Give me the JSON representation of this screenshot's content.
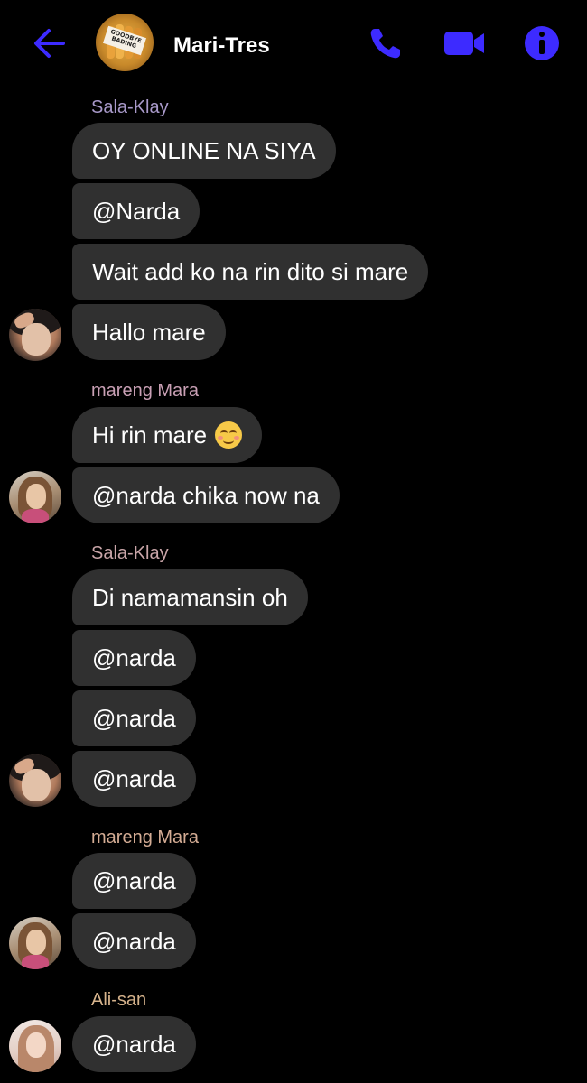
{
  "header": {
    "title": "Mari-Tres",
    "group_avatar_text": "GOODBYE BADING",
    "icons": [
      "back-arrow-icon",
      "phone-icon",
      "video-camera-icon",
      "info-icon"
    ],
    "accent_color": "#3d2bff"
  },
  "colors": {
    "bubble_bg": "#303030",
    "sender_salaklay": "#a899c9",
    "sender_mara": "#c9a0b5",
    "sender_salaklay_2": "#c9a5a8",
    "sender_mara_2": "#d4ac94",
    "sender_alisan": "#d6b38c"
  },
  "messages": {
    "g1": {
      "sender": "Sala-Klay",
      "m1": "OY ONLINE NA SIYA",
      "m2": "@Narda",
      "m3": "Wait add ko na rin dito si mare",
      "m4": "Hallo mare"
    },
    "g2": {
      "sender": "mareng Mara",
      "m1": "Hi rin mare",
      "m2": "@narda chika now na"
    },
    "g3": {
      "sender": "Sala-Klay",
      "m1": "Di namamansin oh",
      "m2": "@narda",
      "m3": "@narda",
      "m4": "@narda"
    },
    "g4": {
      "sender": "mareng Mara",
      "m1": "@narda",
      "m2": "@narda"
    },
    "g5": {
      "sender": "Ali-san",
      "m1": "@narda"
    }
  }
}
